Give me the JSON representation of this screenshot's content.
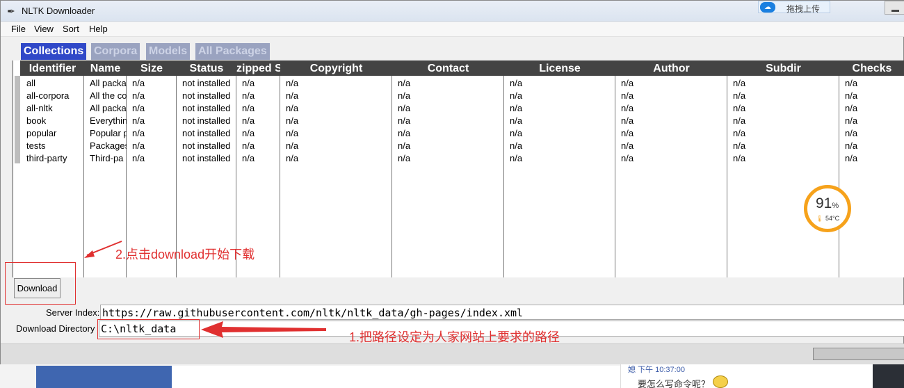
{
  "window": {
    "title": "NLTK Downloader"
  },
  "tray": {
    "upload_label": "拖拽上传",
    "upload_icon": "cloud-icon"
  },
  "menu": [
    "File",
    "View",
    "Sort",
    "Help"
  ],
  "tabs": [
    {
      "label": "Collections",
      "active": true
    },
    {
      "label": "Corpora",
      "active": false
    },
    {
      "label": "Models",
      "active": false
    },
    {
      "label": "All Packages",
      "active": false
    }
  ],
  "table": {
    "columns": [
      "Identifier",
      "Name",
      "Size",
      "Status",
      "zipped S",
      "Copyright",
      "Contact",
      "License",
      "Author",
      "Subdir",
      "Checks"
    ],
    "rows": [
      [
        "all",
        "All packa",
        "n/a",
        "not installed",
        "n/a",
        "n/a",
        "n/a",
        "n/a",
        "n/a",
        "n/a",
        "n/a"
      ],
      [
        "all-corpora",
        "All the co",
        "n/a",
        "not installed",
        "n/a",
        "n/a",
        "n/a",
        "n/a",
        "n/a",
        "n/a",
        "n/a"
      ],
      [
        "all-nltk",
        "All packa",
        "n/a",
        "not installed",
        "n/a",
        "n/a",
        "n/a",
        "n/a",
        "n/a",
        "n/a",
        "n/a"
      ],
      [
        "book",
        "Everythin",
        "n/a",
        "not installed",
        "n/a",
        "n/a",
        "n/a",
        "n/a",
        "n/a",
        "n/a",
        "n/a"
      ],
      [
        "popular",
        "Popular p",
        "n/a",
        "not installed",
        "n/a",
        "n/a",
        "n/a",
        "n/a",
        "n/a",
        "n/a",
        "n/a"
      ],
      [
        "tests",
        "Packages",
        "n/a",
        "not installed",
        "n/a",
        "n/a",
        "n/a",
        "n/a",
        "n/a",
        "n/a",
        "n/a"
      ],
      [
        "third-party",
        "Third-pa",
        "n/a",
        "not installed",
        "n/a",
        "n/a",
        "n/a",
        "n/a",
        "n/a",
        "n/a",
        "n/a"
      ]
    ]
  },
  "download_button": "Download",
  "server_index": {
    "label": "Server Index:",
    "value": "https://raw.githubusercontent.com/nltk/nltk_data/gh-pages/index.xml"
  },
  "download_dir": {
    "label": "Download Directory",
    "value": "C:\\nltk_data"
  },
  "annotations": {
    "step2": "2.点击download开始下载",
    "step1": "1.把路径设定为人家网站上要求的路径"
  },
  "gauge": {
    "value": "91",
    "unit": "%",
    "temp": "54°C"
  },
  "background_chat": {
    "line1": "媳 下午 10:37:00",
    "line2": "要怎么写命令呢？"
  },
  "colors": {
    "tab_active": "#3048c8",
    "tab_inactive": "#9aa3c0",
    "header": "#444444",
    "annotation": "#e03030",
    "gauge": "#f6a21b"
  }
}
